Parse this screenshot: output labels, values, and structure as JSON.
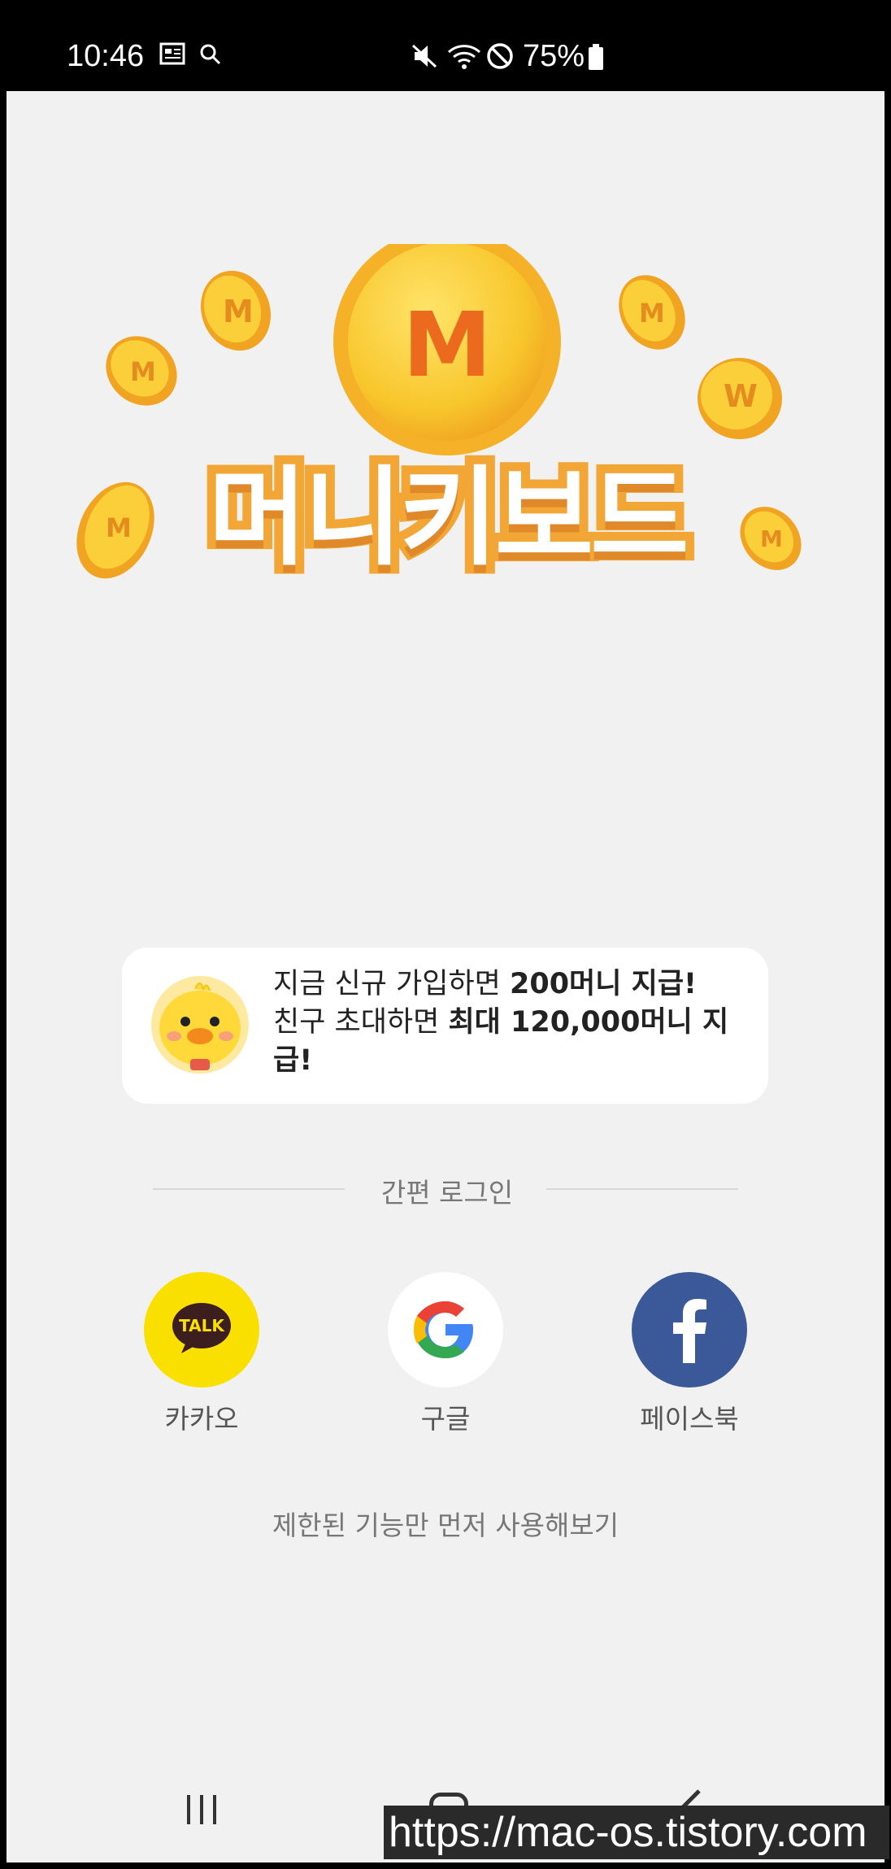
{
  "status_bar": {
    "time": "10:46",
    "battery": "75%"
  },
  "logo": {
    "text": "머니키보드",
    "coin_letter": "M"
  },
  "promo": {
    "line1_prefix": "지금 신규 가입하면 ",
    "line1_bold": "200머니 지급!",
    "line2_prefix": "친구 초대하면 ",
    "line2_bold": "최대 120,000머니 지급!"
  },
  "login": {
    "divider_label": "간편 로그인",
    "kakao_label": "카카오",
    "kakao_badge": "TALK",
    "google_label": "구글",
    "facebook_label": "페이스북",
    "skip_label": "제한된 기능만 먼저 사용해보기"
  },
  "watermark": "https://mac-os.tistory.com",
  "colors": {
    "kakao": "#f9e000",
    "facebook": "#3b5898",
    "coin": "#f7c52b",
    "logo_outline": "#f2a636"
  }
}
